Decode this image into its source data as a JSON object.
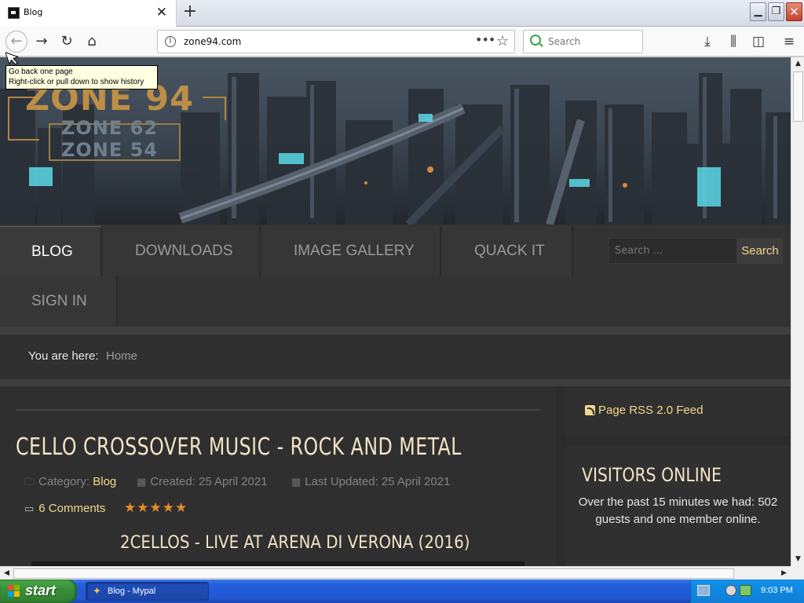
{
  "browser": {
    "tab_title": "Blog",
    "url": "zone94.com",
    "search_placeholder": "Search",
    "tooltip_line1": "Go back one page",
    "tooltip_line2": "Right-click or pull down to show history"
  },
  "site": {
    "logo_main": "ZONE 94",
    "logo_sub1": "ZONE 62",
    "logo_sub2": "ZONE 54",
    "menu": [
      {
        "label": "BLOG",
        "active": true
      },
      {
        "label": "DOWNLOADS"
      },
      {
        "label": "IMAGE GALLERY"
      },
      {
        "label": "QUACK IT"
      },
      {
        "label": "SIGN IN"
      }
    ],
    "search_placeholder": "Search ...",
    "search_button": "Search",
    "breadcrumb_label": "You are here:",
    "breadcrumb_home": "Home"
  },
  "article": {
    "title": "CELLO CROSSOVER MUSIC - ROCK AND METAL",
    "category_label": "Category:",
    "category": "Blog",
    "created": "Created: 25 April 2021",
    "updated": "Last Updated: 25 April 2021",
    "comments": "6 Comments",
    "rating_stars": 5,
    "video_title": "2CELLOS - LIVE AT ARENA DI VERONA (2016)"
  },
  "sidebar": {
    "rss": "Page RSS 2.0 Feed",
    "visitors_title": "VISITORS ONLINE",
    "visitors_text": "Over the past 15 minutes we had: 502 guests and one member online."
  },
  "taskbar": {
    "start": "start",
    "task_label": "Blog - Mypal",
    "clock": "9:03 PM"
  },
  "colors": {
    "accent_gold": "#f1d88e",
    "heading_cream": "#f2e3c6",
    "star_orange": "#e48c2a",
    "page_bg": "#2b2b2b"
  }
}
